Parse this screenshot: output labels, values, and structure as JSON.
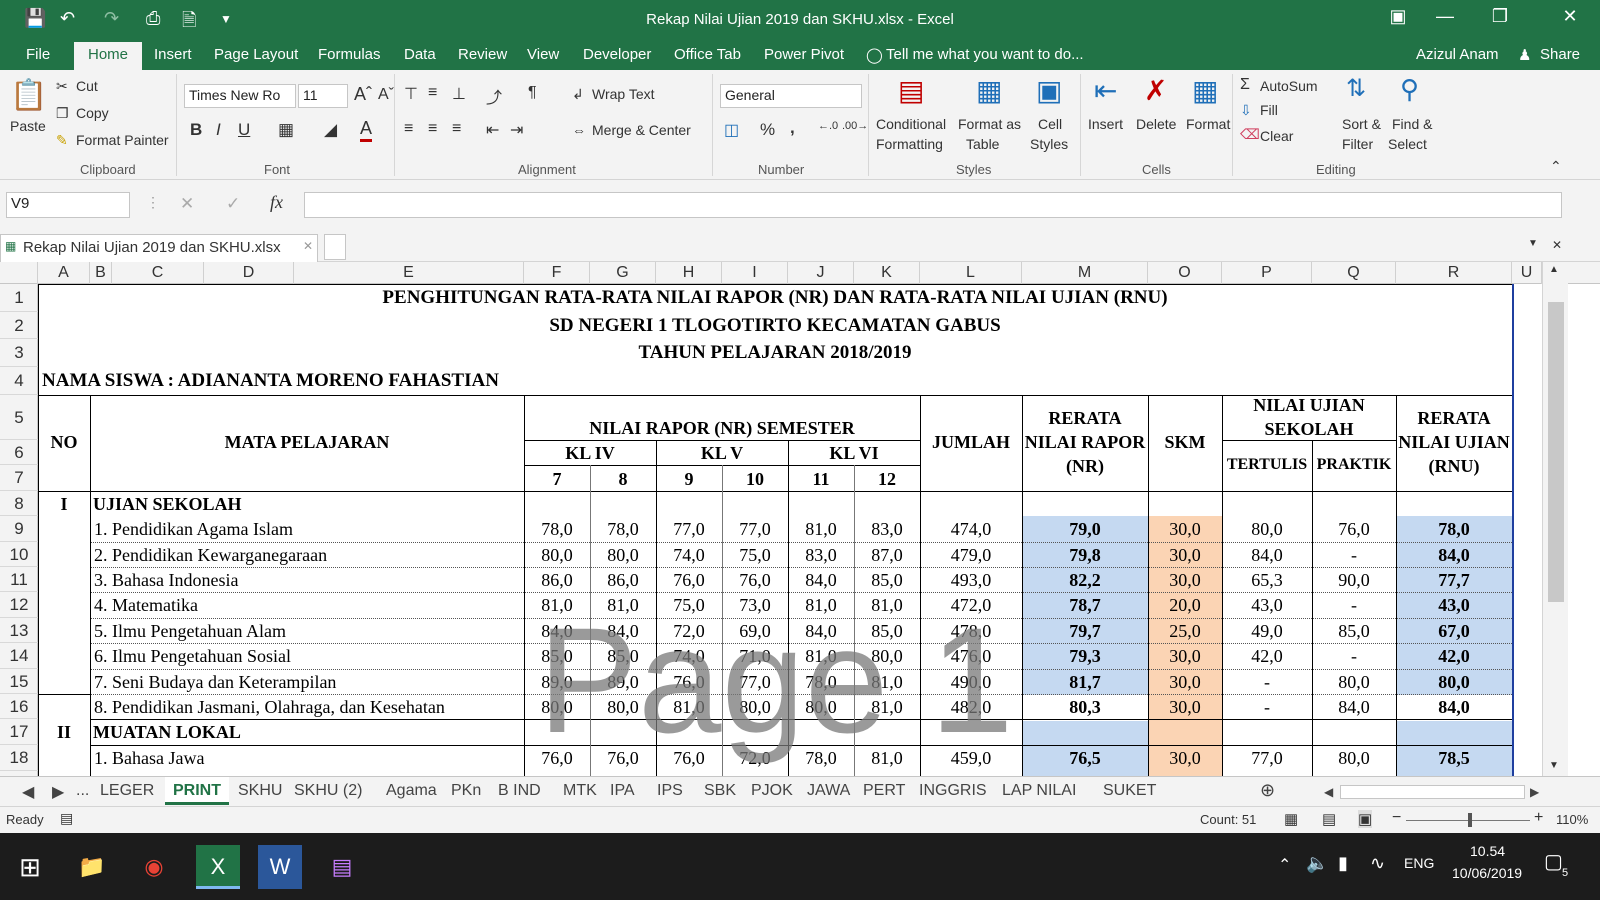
{
  "window": {
    "title": "Rekap Nilai Ujian 2019 dan SKHU.xlsx - Excel",
    "user": "Azizul Anam",
    "share": "Share"
  },
  "tabs": [
    "File",
    "Home",
    "Insert",
    "Page Layout",
    "Formulas",
    "Data",
    "Review",
    "View",
    "Developer",
    "Office Tab",
    "Power Pivot"
  ],
  "tell_me": "Tell me what you want to do...",
  "ribbon": {
    "clipboard": {
      "paste": "Paste",
      "cut": "Cut",
      "copy": "Copy",
      "format_painter": "Format Painter",
      "label": "Clipboard"
    },
    "font": {
      "name": "Times New Ro",
      "size": "11",
      "label": "Font",
      "bold": "B",
      "italic": "I",
      "underline": "U"
    },
    "alignment": {
      "wrap": "Wrap Text",
      "merge": "Merge & Center",
      "label": "Alignment"
    },
    "number": {
      "format": "General",
      "label": "Number",
      "percent": "%",
      "comma": ","
    },
    "styles": {
      "cond": "Conditional",
      "cond2": "Formatting",
      "fmt_table": "Format as",
      "fmt_table2": "Table",
      "cell_styles": "Cell",
      "cell_styles2": "Styles",
      "label": "Styles"
    },
    "cells": {
      "insert": "Insert",
      "delete": "Delete",
      "format": "Format",
      "label": "Cells"
    },
    "editing": {
      "autosum": "AutoSum",
      "fill": "Fill",
      "clear": "Clear",
      "sort": "Sort &",
      "sort2": "Filter",
      "find": "Find &",
      "find2": "Select",
      "label": "Editing"
    }
  },
  "name_box": "V9",
  "fx": "fx",
  "workbook_tab": "Rekap Nilai Ujian 2019 dan SKHU.xlsx",
  "columns": [
    "A",
    "B",
    "C",
    "D",
    "E",
    "F",
    "G",
    "H",
    "I",
    "J",
    "K",
    "L",
    "M",
    "O",
    "P",
    "Q",
    "R",
    "U"
  ],
  "rows": [
    "1",
    "2",
    "3",
    "4",
    "5",
    "6",
    "7",
    "8",
    "9",
    "10",
    "11",
    "12",
    "13",
    "14",
    "15",
    "16",
    "17",
    "18"
  ],
  "sheet": {
    "title1": "PENGHITUNGAN RATA-RATA NILAI RAPOR (NR) DAN RATA-RATA NILAI UJIAN (RNU)",
    "title2": "SD NEGERI 1 TLOGOTIRTO KECAMATAN GABUS",
    "title3": "TAHUN PELAJARAN 2018/2019",
    "student": "NAMA SISWA : ADIANANTA MORENO FAHASTIAN",
    "h_no": "NO",
    "h_mapel": "MATA PELAJARAN",
    "h_nr": "NILAI RAPOR (NR) SEMESTER",
    "h_kl4": "KL IV",
    "h_kl5": "KL V",
    "h_kl6": "KL VI",
    "sems": [
      "7",
      "8",
      "9",
      "10",
      "11",
      "12"
    ],
    "h_jumlah": "JUMLAH",
    "h_rerata1": "RERATA",
    "h_rerata2": "NILAI RAPOR",
    "h_rerata3": "(NR)",
    "h_skm": "SKM",
    "h_nus1": "NILAI UJIAN",
    "h_nus2": "SEKOLAH",
    "h_tertulis": "TERTULIS",
    "h_praktik": "PRAKTIK",
    "h_rnu1": "RERATA",
    "h_rnu2": "NILAI UJIAN",
    "h_rnu3": "(RNU)",
    "sec1_no": "I",
    "sec1": "UJIAN SEKOLAH",
    "sec2_no": "II",
    "sec2": "MUATAN LOKAL",
    "subjects": [
      {
        "name": "1.  Pendidikan Agama Islam",
        "v": [
          "78,0",
          "78,0",
          "77,0",
          "77,0",
          "81,0",
          "83,0"
        ],
        "jumlah": "474,0",
        "nr": "79,0",
        "skm": "30,0",
        "tertulis": "80,0",
        "praktik": "76,0",
        "rnu": "78,0"
      },
      {
        "name": "2.  Pendidikan Kewarganegaraan",
        "v": [
          "80,0",
          "80,0",
          "74,0",
          "75,0",
          "83,0",
          "87,0"
        ],
        "jumlah": "479,0",
        "nr": "79,8",
        "skm": "30,0",
        "tertulis": "84,0",
        "praktik": "-",
        "rnu": "84,0"
      },
      {
        "name": "3.  Bahasa Indonesia",
        "v": [
          "86,0",
          "86,0",
          "76,0",
          "76,0",
          "84,0",
          "85,0"
        ],
        "jumlah": "493,0",
        "nr": "82,2",
        "skm": "30,0",
        "tertulis": "65,3",
        "praktik": "90,0",
        "rnu": "77,7"
      },
      {
        "name": "4.  Matematika",
        "v": [
          "81,0",
          "81,0",
          "75,0",
          "73,0",
          "81,0",
          "81,0"
        ],
        "jumlah": "472,0",
        "nr": "78,7",
        "skm": "20,0",
        "tertulis": "43,0",
        "praktik": "-",
        "rnu": "43,0"
      },
      {
        "name": "5.  Ilmu Pengetahuan Alam",
        "v": [
          "84,0",
          "84,0",
          "72,0",
          "69,0",
          "84,0",
          "85,0"
        ],
        "jumlah": "478,0",
        "nr": "79,7",
        "skm": "25,0",
        "tertulis": "49,0",
        "praktik": "85,0",
        "rnu": "67,0"
      },
      {
        "name": "6.  Ilmu Pengetahuan Sosial",
        "v": [
          "85,0",
          "85,0",
          "74,0",
          "71,0",
          "81,0",
          "80,0"
        ],
        "jumlah": "476,0",
        "nr": "79,3",
        "skm": "30,0",
        "tertulis": "42,0",
        "praktik": "-",
        "rnu": "42,0"
      },
      {
        "name": "7.  Seni Budaya dan Keterampilan",
        "v": [
          "89,0",
          "89,0",
          "76,0",
          "77,0",
          "78,0",
          "81,0"
        ],
        "jumlah": "490,0",
        "nr": "81,7",
        "skm": "30,0",
        "tertulis": "-",
        "praktik": "80,0",
        "rnu": "80,0"
      },
      {
        "name": "8.  Pendidikan Jasmani, Olahraga, dan Kesehatan",
        "v": [
          "80,0",
          "80,0",
          "81,0",
          "80,0",
          "80,0",
          "81,0"
        ],
        "jumlah": "482,0",
        "nr": "80,3",
        "skm": "30,0",
        "tertulis": "-",
        "praktik": "84,0",
        "rnu": "84,0"
      },
      {
        "name": "1.  Bahasa Jawa",
        "v": [
          "76,0",
          "76,0",
          "76,0",
          "72,0",
          "78,0",
          "81,0"
        ],
        "jumlah": "459,0",
        "nr": "76,5",
        "skm": "30,0",
        "tertulis": "77,0",
        "praktik": "80,0",
        "rnu": "78,5"
      }
    ],
    "watermark": "Page 1"
  },
  "sheet_tabs": [
    "LEGER",
    "PRINT",
    "SKHU",
    "SKHU (2)",
    "Agama",
    "PKn",
    "B IND",
    "MTK",
    "IPA",
    "IPS",
    "SBK",
    "PJOK",
    "JAWA",
    "PERT",
    "INGGRIS",
    "LAP NILAI",
    "SUKET"
  ],
  "status": {
    "ready": "Ready",
    "count": "Count: 51",
    "zoom": "110%"
  },
  "taskbar": {
    "lang": "ENG",
    "time": "10.54",
    "date": "10/06/2019",
    "notif": "5"
  }
}
